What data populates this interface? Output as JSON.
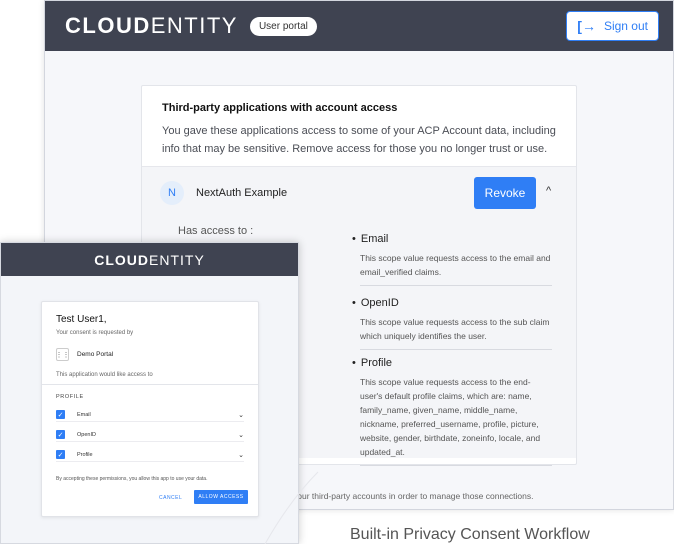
{
  "portal": {
    "logo_prefix": "CLOUD",
    "logo_suffix": "ENTITY",
    "badge": "User portal",
    "signout_icon": "sign-out-icon",
    "signout_label": "Sign out",
    "card": {
      "title": "Third-party applications with account access",
      "description": "You gave these applications access to some of your ACP Account data, including info that may be sensitive. Remove access for those you no longer trust or use.",
      "app": {
        "avatar_letter": "N",
        "name": "NextAuth Example",
        "revoke_label": "Revoke",
        "has_access_label": "Has access to :",
        "scopes": [
          {
            "name": "Email",
            "description": "This scope value requests access to the email and email_verified claims."
          },
          {
            "name": "OpenID",
            "description": "This scope value requests access to the sub claim which uniquely identifies the user."
          },
          {
            "name": "Profile",
            "description": "This scope value requests access to the end-user's default profile claims, which are: name, family_name, given_name, middle_name, nickname, preferred_username, profile, picture, website, gender, birthdate, zoneinfo, locale, and updated_at."
          }
        ]
      }
    },
    "footer_note": "your third-party accounts in order to manage those connections."
  },
  "consent": {
    "logo_prefix": "CLOUD",
    "logo_suffix": "ENTITY",
    "greeting": "Test User1,",
    "subtitle": "Your consent is requested by",
    "app_name": "Demo Portal",
    "access_text": "This application would like access to",
    "section": "PROFILE",
    "permissions": [
      {
        "label": "Email",
        "checked": true
      },
      {
        "label": "OpenID",
        "checked": true
      },
      {
        "label": "Profile",
        "checked": true
      }
    ],
    "note": "By accepting these permissions, you allow this app to use your data.",
    "cancel_label": "CANCEL",
    "allow_label": "ALLOW ACCESS"
  },
  "caption": "Built-in Privacy Consent Workflow",
  "colors": {
    "header": "#3f4351",
    "accent": "#2f7ef5"
  }
}
